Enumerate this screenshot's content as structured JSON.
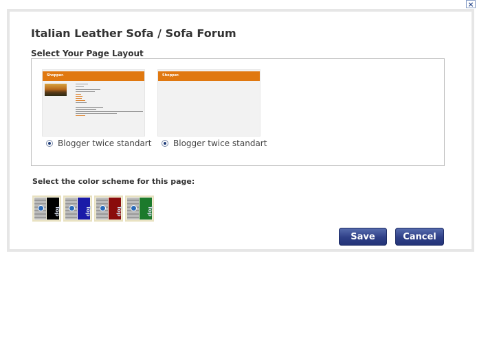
{
  "close_label": "×",
  "dialog": {
    "title": "Italian Leather Sofa / Sofa Forum",
    "layout_heading": "Select Your Page Layout",
    "layouts": [
      {
        "label": "Blogger twice standart",
        "selected": true,
        "thumb_logo": "Shopper."
      },
      {
        "label": "Blogger twice standart",
        "selected": true,
        "thumb_logo": "Shopper."
      }
    ],
    "color_heading": "Select the color scheme for this page:",
    "color_schemes": [
      {
        "name": "black",
        "color": "#000000",
        "tab_text": "Top"
      },
      {
        "name": "blue",
        "color": "#1a1aa8",
        "tab_text": "Top"
      },
      {
        "name": "red",
        "color": "#8a0c0c",
        "tab_text": "Top"
      },
      {
        "name": "green",
        "color": "#1c7a2c",
        "tab_text": "Top"
      }
    ],
    "save_label": "Save",
    "cancel_label": "Cancel"
  },
  "colors": {
    "accent": "#e07810",
    "button": "#2e3f87"
  }
}
